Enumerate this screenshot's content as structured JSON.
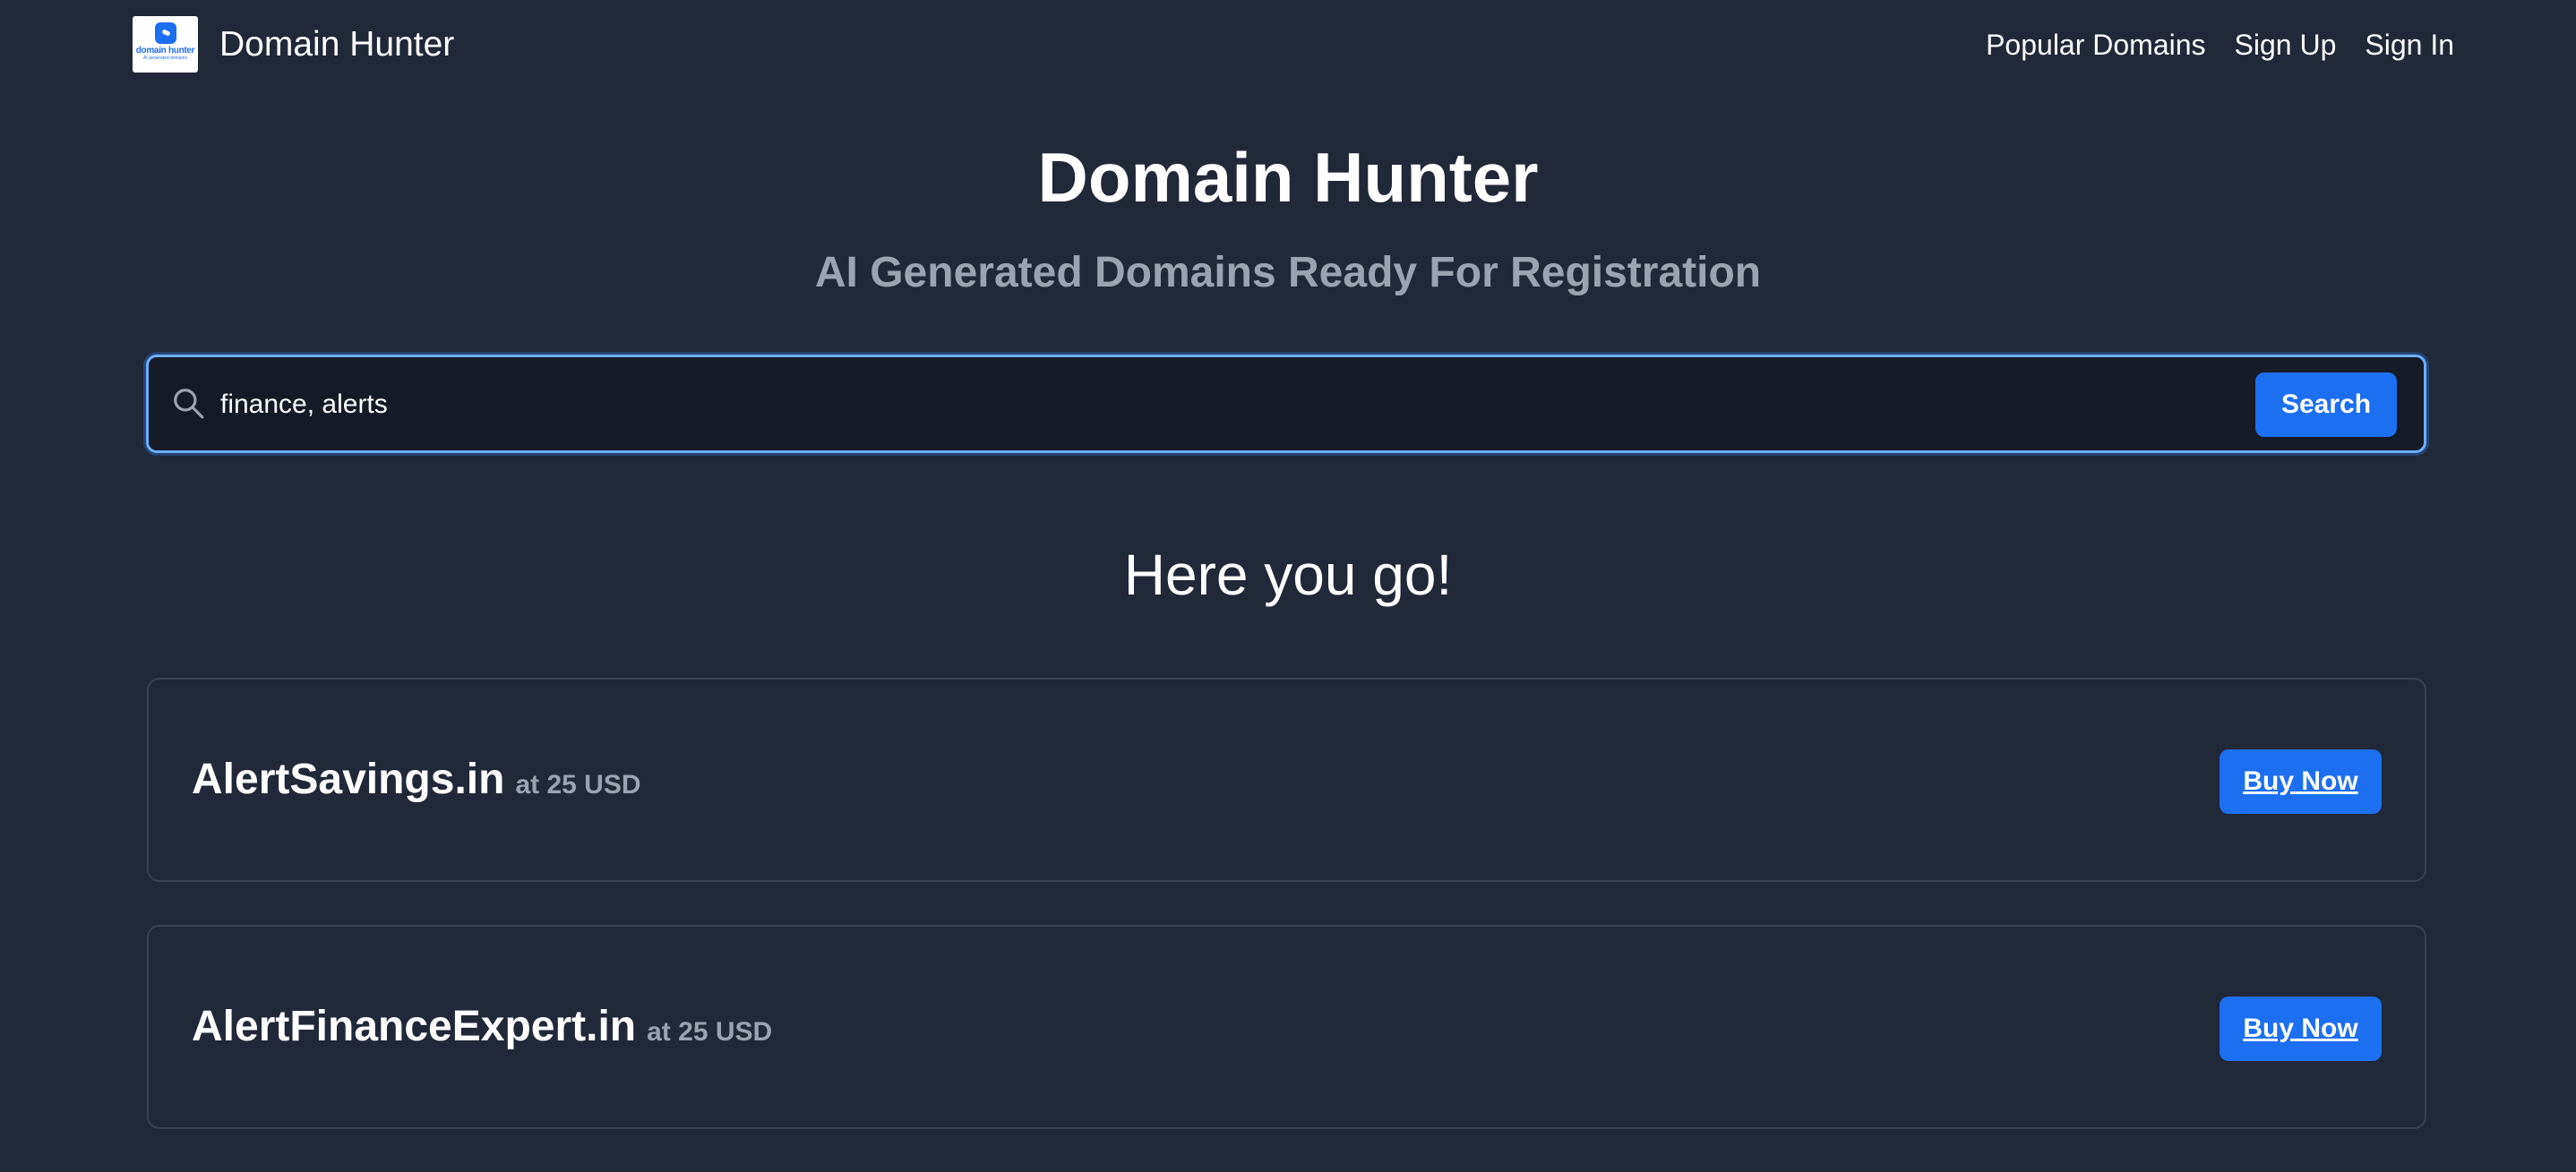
{
  "nav": {
    "brand_name": "Domain Hunter",
    "logo_text": "domain hunter",
    "logo_subtext": "AI generated domains",
    "links": [
      {
        "label": "Popular Domains"
      },
      {
        "label": "Sign Up"
      },
      {
        "label": "Sign In"
      }
    ]
  },
  "hero": {
    "title": "Domain Hunter",
    "subtitle": "AI Generated Domains Ready For Registration"
  },
  "search": {
    "value": "finance, alerts",
    "button_label": "Search",
    "icon": "search-icon"
  },
  "results": {
    "heading": "Here you go!",
    "items": [
      {
        "domain": "AlertSavings.in",
        "price": "at 25 USD",
        "button_label": "Buy Now"
      },
      {
        "domain": "AlertFinanceExpert.in",
        "price": "at 25 USD",
        "button_label": "Buy Now"
      }
    ]
  },
  "colors": {
    "background": "#212837",
    "accent": "#1d6ff2",
    "muted_text": "#9aa3af",
    "search_border": "#6aaeff"
  }
}
